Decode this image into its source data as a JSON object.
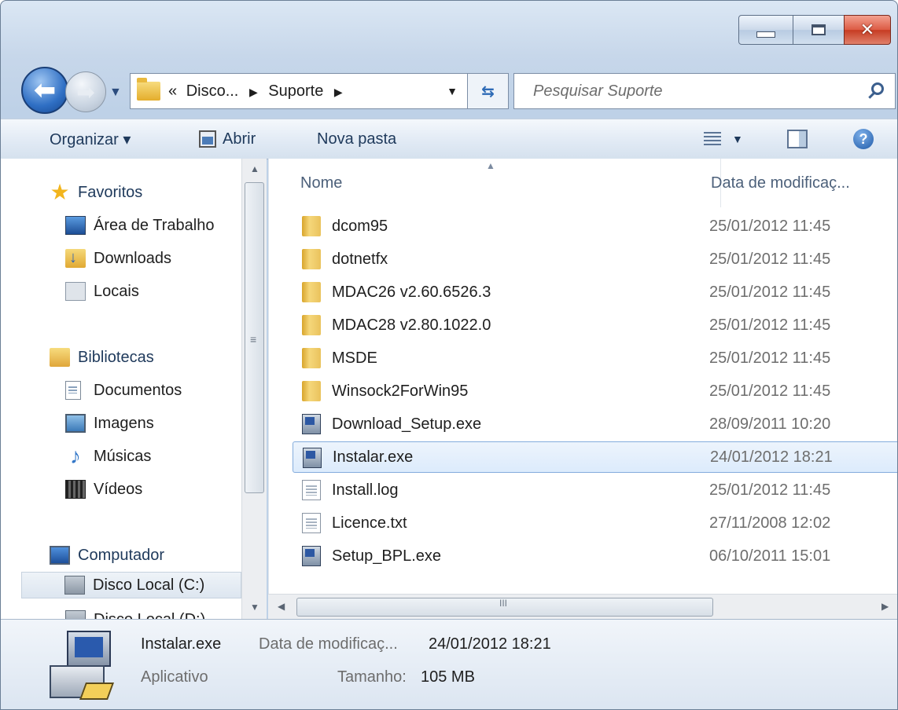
{
  "window": {
    "controls": {
      "minimize": "minimize",
      "maximize": "maximize",
      "close": "✕"
    }
  },
  "nav": {
    "breadcrumb": {
      "overflow": "«",
      "items": [
        "Disco...",
        "Suporte"
      ]
    },
    "search": {
      "placeholder": "Pesquisar Suporte",
      "value": ""
    }
  },
  "toolbar": {
    "organize": "Organizar ▾",
    "open": "Abrir",
    "new_folder": "Nova pasta",
    "help": "?"
  },
  "sidebar": {
    "favorites": "Favoritos",
    "favorites_items": [
      "Área de Trabalho",
      "Downloads",
      "Locais"
    ],
    "libraries": "Bibliotecas",
    "libraries_items": [
      "Documentos",
      "Imagens",
      "Músicas",
      "Vídeos"
    ],
    "computer": "Computador",
    "computer_items": [
      "Disco Local (C:)",
      "Disco Local (D:)"
    ]
  },
  "filelist": {
    "columns": {
      "name": "Nome",
      "date": "Data de modificaç..."
    },
    "scroll_grip": "III",
    "rows": [
      {
        "name": "dcom95",
        "date": "25/01/2012 11:45",
        "icon": "folder-icon"
      },
      {
        "name": "dotnetfx",
        "date": "25/01/2012 11:45",
        "icon": "folder-icon"
      },
      {
        "name": "MDAC26 v2.60.6526.3",
        "date": "25/01/2012 11:45",
        "icon": "folder-icon"
      },
      {
        "name": "MDAC28 v2.80.1022.0",
        "date": "25/01/2012 11:45",
        "icon": "folder-icon"
      },
      {
        "name": "MSDE",
        "date": "25/01/2012 11:45",
        "icon": "folder-icon"
      },
      {
        "name": "Winsock2ForWin95",
        "date": "25/01/2012 11:45",
        "icon": "folder-icon"
      },
      {
        "name": "Download_Setup.exe",
        "date": "28/09/2011 10:20",
        "icon": "exe-icon"
      },
      {
        "name": "Instalar.exe",
        "date": "24/01/2012 18:21",
        "icon": "exe-icon",
        "selected": true
      },
      {
        "name": "Install.log",
        "date": "25/01/2012 11:45",
        "icon": "text-file-icon"
      },
      {
        "name": "Licence.txt",
        "date": "27/11/2008 12:02",
        "icon": "text-file-icon"
      },
      {
        "name": "Setup_BPL.exe",
        "date": "06/10/2011 15:01",
        "icon": "exe-icon"
      }
    ]
  },
  "details": {
    "name": "Instalar.exe",
    "type": "Aplicativo",
    "modified_label": "Data de modificaç...",
    "modified_value": "24/01/2012 18:21",
    "size_label": "Tamanho:",
    "size_value": "105 MB"
  },
  "colors": {
    "accent": "#3470c0",
    "selection_bg": "#dcebfc",
    "selection_border": "#84acdd"
  }
}
